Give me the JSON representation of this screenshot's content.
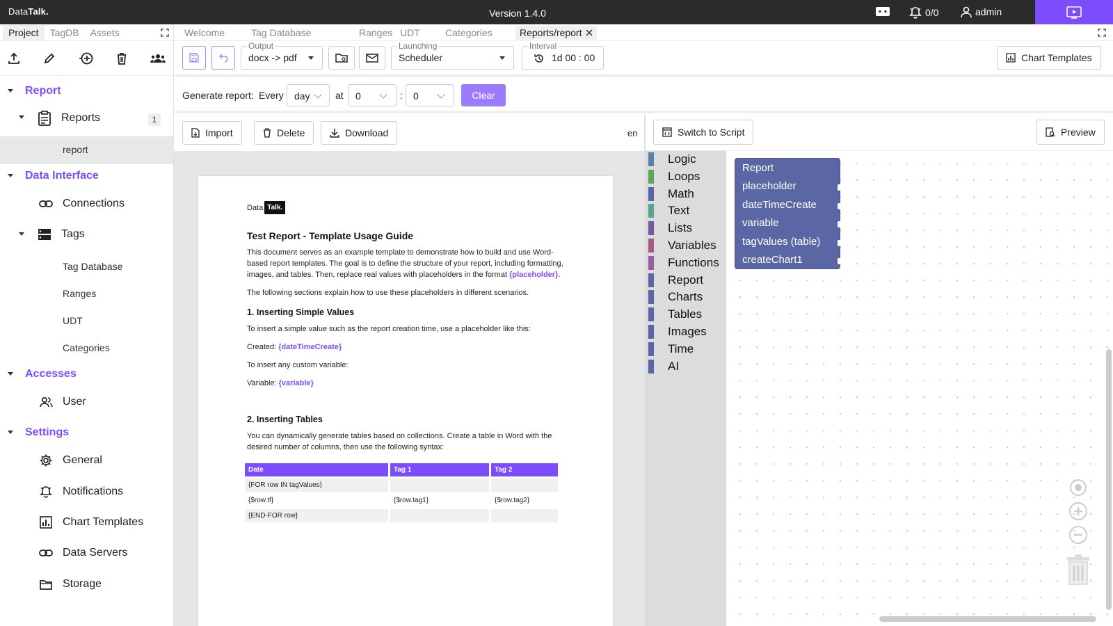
{
  "topbar": {
    "logo_prefix": "Data",
    "logo_suffix": "Talk.",
    "version": "Version 1.4.0",
    "alarm_count": "0/0",
    "user": "admin",
    "accent": "#7b4dff"
  },
  "left_tabs": [
    {
      "label": "Project"
    },
    {
      "label": "TagDB"
    },
    {
      "label": "Assets"
    }
  ],
  "tree": {
    "report_section": "Report",
    "reports_label": "Reports",
    "reports_count": "1",
    "report_item": "report",
    "data_interface_section": "Data Interface",
    "connections": "Connections",
    "tags": "Tags",
    "tag_database": "Tag Database",
    "ranges": "Ranges",
    "udt": "UDT",
    "categories": "Categories",
    "accesses_section": "Accesses",
    "user": "User",
    "settings_section": "Settings",
    "general": "General",
    "notifications": "Notifications",
    "chart_templates": "Chart Templates",
    "data_servers": "Data Servers",
    "storage": "Storage"
  },
  "main_tabs": [
    {
      "label": "Welcome"
    },
    {
      "label": "Tag Database"
    },
    {
      "label": "Ranges"
    },
    {
      "label": "UDT"
    },
    {
      "label": "Categories"
    },
    {
      "label": "Reports/report"
    }
  ],
  "toolbar": {
    "output_label": "Output",
    "output_value": "docx -> pdf",
    "launching_label": "Launching",
    "launching_value": "Scheduler",
    "interval_label": "Interval",
    "interval_value": "1d 00 : 00",
    "chart_templates_button": "Chart Templates"
  },
  "schedule": {
    "generate_label": "Generate report:",
    "every_label": "Every",
    "period": "day",
    "at_label": "at",
    "hour": "0",
    "colon": ":",
    "minute": "0",
    "clear_button": "Clear"
  },
  "doc_toolbar": {
    "import": "Import",
    "delete": "Delete",
    "download": "Download",
    "language": "en"
  },
  "document": {
    "logo_prefix": "Data",
    "logo_suffix": "Talk.",
    "title": "Test Report - Template Usage Guide",
    "intro": "This document serves as an example template to demonstrate how to build and use Word-based report templates. The goal is to define the structure of your report, including formatting, images, and tables. Then, replace real values with placeholders in the format ",
    "intro_placeholder": "{placeholder}",
    "intro_end": ".",
    "sections_intro": "The following sections explain how to use these placeholders in different scenarios.",
    "h1": "1. Inserting Simple Values",
    "simple_text": "To insert a simple value such as the report creation time, use a placeholder like this:",
    "created_label": "Created: ",
    "created_placeholder": "{dateTimeCreate}",
    "custom_text": "To insert any custom variable:",
    "variable_label": "Variable: ",
    "variable_placeholder": "{variable}",
    "h2": "2. Inserting Tables",
    "tables_text": "You can dynamically generate tables based on collections. Create a table in Word with the desired number of columns, then use the following syntax:",
    "table_headers": [
      "Date",
      "Tag 1",
      "Tag 2"
    ],
    "table_rows": [
      [
        "{FOR row IN tagValues}",
        "",
        ""
      ],
      [
        "{$row.tf}",
        "{$row.tag1}",
        "{$row.tag2}"
      ],
      [
        "{END-FOR row}",
        "",
        ""
      ]
    ]
  },
  "script_toolbar": {
    "switch_to_script": "Switch to Script",
    "preview": "Preview"
  },
  "toolbox": [
    {
      "label": "Logic",
      "color": "#5b80a5"
    },
    {
      "label": "Loops",
      "color": "#5ba55b"
    },
    {
      "label": "Math",
      "color": "#5b67a5"
    },
    {
      "label": "Text",
      "color": "#5ba58c"
    },
    {
      "label": "Lists",
      "color": "#745ba5"
    },
    {
      "label": "Variables",
      "color": "#a55b80"
    },
    {
      "label": "Functions",
      "color": "#995ba5"
    },
    {
      "label": "Report",
      "color": "#5b67a5"
    },
    {
      "label": "Charts",
      "color": "#5b67a5"
    },
    {
      "label": "Tables",
      "color": "#5b67a5"
    },
    {
      "label": "Images",
      "color": "#5b67a5"
    },
    {
      "label": "Time",
      "color": "#5b67a5"
    },
    {
      "label": "AI",
      "color": "#5b67a5"
    }
  ],
  "block": {
    "title": "Report",
    "inputs": [
      "placeholder",
      "dateTimeCreate",
      "variable",
      "tagValues (table)",
      "createChart1"
    ]
  }
}
